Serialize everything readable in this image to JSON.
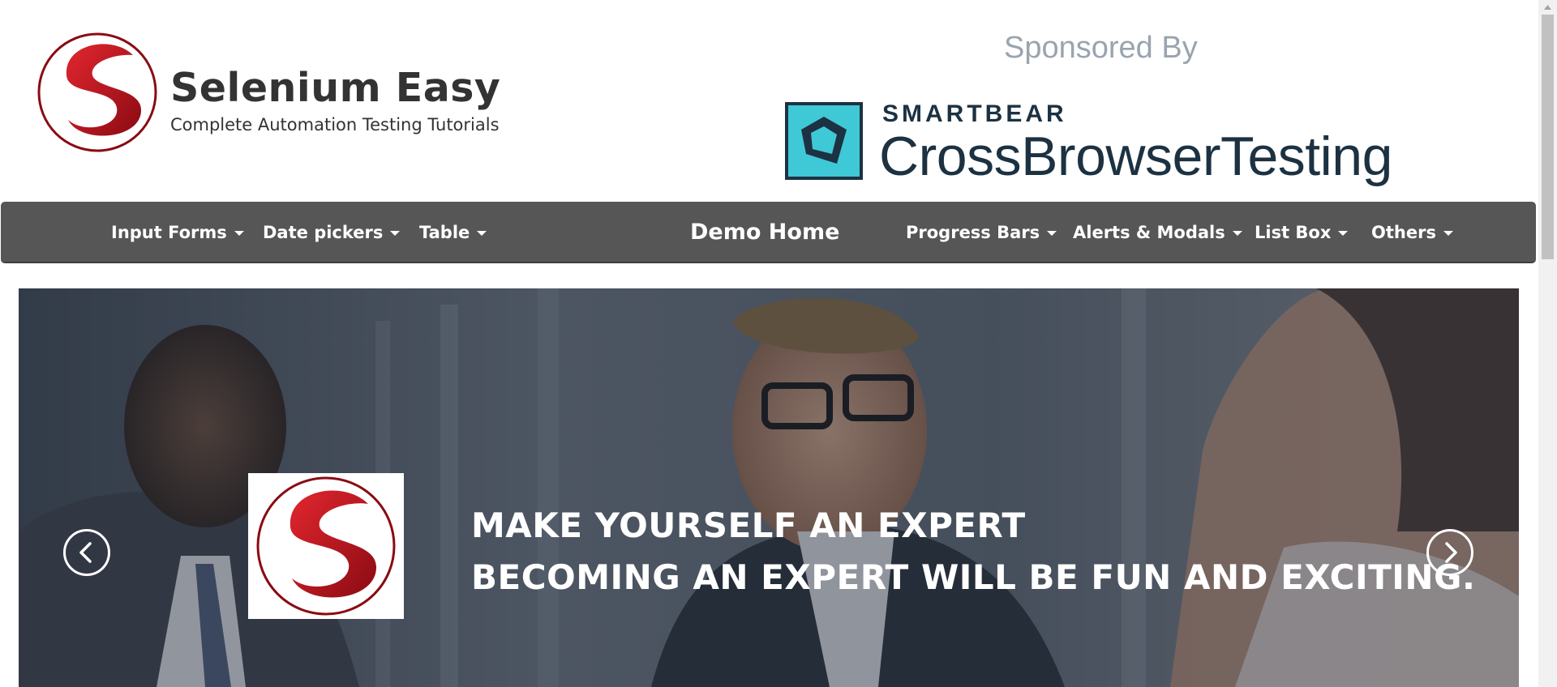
{
  "header": {
    "brand_title": "Selenium Easy",
    "brand_subtitle": "Complete Automation Testing Tutorials",
    "sponsor_label": "Sponsored By",
    "sponsor_small": "SMARTBEAR",
    "sponsor_large": "CrossBrowserTesting"
  },
  "nav": {
    "items_left": [
      "Input Forms",
      "Date pickers",
      "Table"
    ],
    "home": "Demo Home",
    "items_right": [
      "Progress Bars",
      "Alerts & Modals",
      "List Box",
      "Others"
    ]
  },
  "carousel": {
    "line1": "MAKE YOURSELF AN EXPERT",
    "line2": "BECOMING AN EXPERT WILL BE FUN AND EXCITING."
  },
  "colors": {
    "nav_bg": "#565656",
    "brand_red": "#c8102e",
    "sponsor_teal": "#3fc8d6",
    "sponsor_navy": "#1c3242"
  },
  "icons": {
    "prev": "chevron-left-icon",
    "next": "chevron-right-icon",
    "caret": "caret-down-icon"
  }
}
